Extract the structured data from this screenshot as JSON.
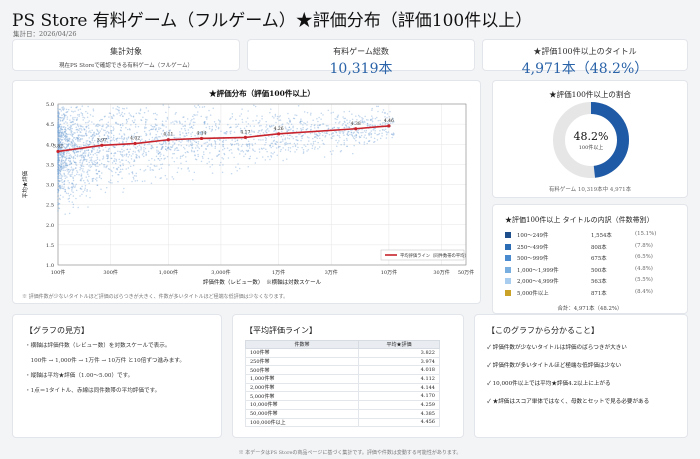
{
  "header": {
    "title": "PS Store 有料ゲーム（フルゲーム）★評価分布（評価100件以上）",
    "date": "集計日：2026/04/26"
  },
  "kpis": [
    {
      "label": "集計対象",
      "value": "",
      "sub": "現在PS Storeで確認できる有料ゲーム（フルゲーム）"
    },
    {
      "label": "有料ゲーム総数",
      "value": "10,319本",
      "sub": ""
    },
    {
      "label": "★評価100件以上のタイトル",
      "value": "4,971本（48.2%）",
      "sub": ""
    }
  ],
  "chart_data": {
    "type": "scatter",
    "title": "★評価分布（評価100件以上）",
    "xlabel": "評価件数（レビュー数）　※横軸は対数スケール",
    "ylabel": "平均★評価",
    "x_scale": "log",
    "xlim": [
      100,
      500000
    ],
    "ylim": [
      1.0,
      5.0
    ],
    "grid": true,
    "legend": "bottom-right",
    "x_ticks": [
      {
        "value": 100,
        "label": "100件"
      },
      {
        "value": 300,
        "label": "300件"
      },
      {
        "value": 1000,
        "label": "1,000件"
      },
      {
        "value": 3000,
        "label": "3,000件"
      },
      {
        "value": 10000,
        "label": "1万件"
      },
      {
        "value": 30000,
        "label": "3万件"
      },
      {
        "value": 100000,
        "label": "10万件"
      },
      {
        "value": 300000,
        "label": "30万件"
      },
      {
        "value": 500000,
        "label": "50万件"
      }
    ],
    "y_ticks": [
      "1.0",
      "1.5",
      "2.0",
      "2.5",
      "3.0",
      "3.5",
      "4.0",
      "4.5",
      "5.0"
    ],
    "series": [
      {
        "name": "平均評価ライン（同件数帯の平均）",
        "color": "#c8232c",
        "x": [
          100,
          250,
          500,
          1000,
          2000,
          5000,
          10000,
          50000,
          100000
        ],
        "y": [
          3.822,
          3.974,
          4.018,
          4.112,
          4.144,
          4.17,
          4.259,
          4.385,
          4.456
        ],
        "labels": [
          "3.82",
          "3.97",
          "4.02",
          "4.11",
          "4.14",
          "4.17",
          "4.26",
          "4.38",
          "4.46"
        ]
      },
      {
        "name": "タイトル（散布）",
        "color": "#7aa7d6"
      }
    ]
  },
  "chart_note": "※ 評価件数が少ないタイトルほど評価のばらつきが大きく、件数が多いタイトルほど極端な低評価は少なくなります。",
  "donut": {
    "title": "★評価100件以上の割合",
    "value": 48.2,
    "center_value": "48.2%",
    "center_label": "100件以上",
    "caption": "有料ゲーム 10,319本中 4,971本",
    "colors": {
      "fill": "#1f5aa6",
      "track": "#e6e6e6"
    }
  },
  "breakdown": {
    "title": "★評価100件以上 タイトルの内訳（件数帯別）",
    "rows": [
      {
        "label": "100〜249件",
        "count": "1,554本",
        "pct": "(15.1%)",
        "color": "#1f4e8c"
      },
      {
        "label": "250〜499件",
        "count": "808本",
        "pct": "(7.8%)",
        "color": "#2c6cb5"
      },
      {
        "label": "500〜999件",
        "count": "675本",
        "pct": "(6.5%)",
        "color": "#4a8bd0"
      },
      {
        "label": "1,000〜1,999件",
        "count": "500本",
        "pct": "(4.8%)",
        "color": "#79aee0"
      },
      {
        "label": "2,000〜4,999件",
        "count": "563本",
        "pct": "(5.5%)",
        "color": "#a8cdee"
      },
      {
        "label": "5,000件以上",
        "count": "871本",
        "pct": "(8.4%)",
        "color": "#c9a227"
      }
    ],
    "total": "合計：4,971本（48.2%）"
  },
  "howto": {
    "title": "【グラフの見方】",
    "lines": [
      "・横軸は評価件数（レビュー数）を対数スケールで表示。",
      "　100件 → 1,000件 → 1万件 → 10万件 と10倍ずつ進みます。",
      "・縦軸は平均★評価（1.00〜5.00）です。",
      "・1点＝1タイトル、赤線は同件数帯の平均評価です。"
    ]
  },
  "avg_table": {
    "title": "【平均評価ライン】",
    "headers": [
      "件数帯",
      "平均★評価"
    ],
    "rows": [
      [
        "100件帯",
        "3.822"
      ],
      [
        "250件帯",
        "3.974"
      ],
      [
        "500件帯",
        "4.018"
      ],
      [
        "1,000件帯",
        "4.112"
      ],
      [
        "2,000件帯",
        "4.144"
      ],
      [
        "5,000件帯",
        "4.170"
      ],
      [
        "10,000件帯",
        "4.259"
      ],
      [
        "50,000件帯",
        "4.385"
      ],
      [
        "100,000件以上",
        "4.456"
      ]
    ]
  },
  "findings": {
    "title": "【このグラフから分かること】",
    "lines": [
      "✓ 評価件数が少ないタイトルは評価のばらつきが大きい",
      "✓ 評価件数が多いタイトルほど極端な低評価は少ない",
      "✓ 10,000件以上では平均★評価4.2以上に上がる",
      "✓ ★評価はスコア単体ではなく、母数とセットで見る必要がある"
    ]
  },
  "footer": "※ 本データはPS Storeの商品ページに基づく集計です。評価や件数は変動する可能性があります。"
}
